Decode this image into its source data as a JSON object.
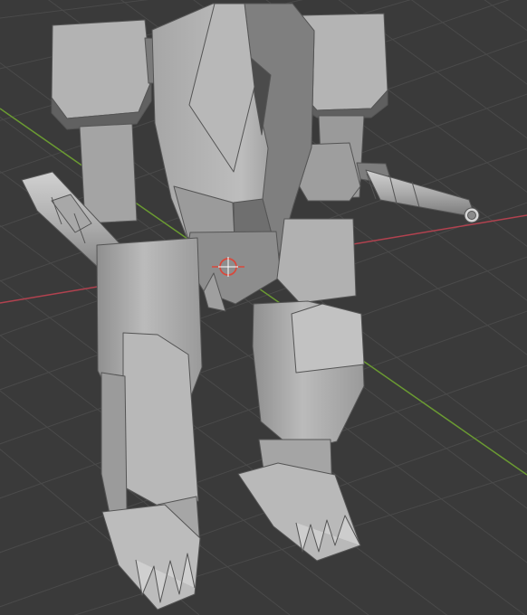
{
  "viewport": {
    "background": "#3a3a3a",
    "grid_color": "#4a4a4a",
    "x_axis_color": "#b1424f",
    "y_axis_color": "#6b9b32",
    "mesh_light": "#b9b9b9",
    "mesh_mid": "#9b9b9b",
    "mesh_dark": "#727272",
    "mesh_edge": "#555555",
    "cursor_color": "#d9483b"
  },
  "scene": {
    "object_icon": "mech-robot-model-icon",
    "cursor_icon": "3d-cursor-icon"
  }
}
